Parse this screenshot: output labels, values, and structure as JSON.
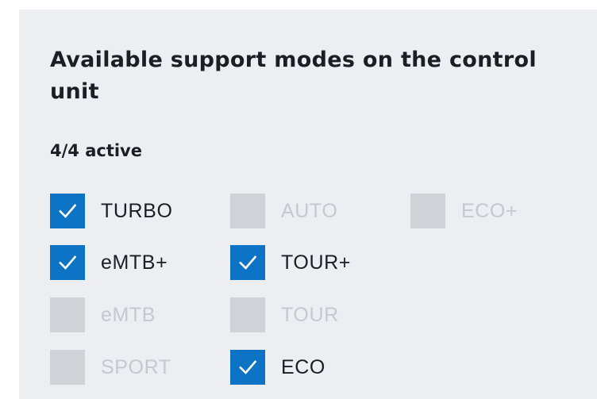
{
  "panel": {
    "title": "Available support modes on the control unit",
    "status": "4/4 active"
  },
  "modes": [
    {
      "label": "TURBO",
      "checked": true
    },
    {
      "label": "AUTO",
      "checked": false
    },
    {
      "label": "ECO+",
      "checked": false
    },
    {
      "label": "eMTB+",
      "checked": true
    },
    {
      "label": "TOUR+",
      "checked": true
    },
    {
      "label": "eMTB",
      "checked": false
    },
    {
      "label": "TOUR",
      "checked": false
    },
    {
      "label": "SPORT",
      "checked": false
    },
    {
      "label": "ECO",
      "checked": true
    }
  ],
  "colors": {
    "panel_bg": "#eceef1",
    "checked_bg": "#0d73c4",
    "unchecked_bg": "#cfd3d8",
    "text": "#1b1e23",
    "disabled_text": "#c5c9ce"
  },
  "icons": {
    "check": "checkmark-icon"
  }
}
